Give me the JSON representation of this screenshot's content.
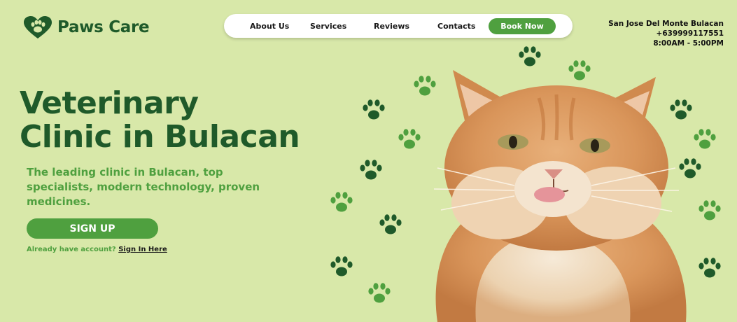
{
  "brand": {
    "name": "Paws Care",
    "logo_icon": "heart-paw-icon"
  },
  "nav": {
    "items": [
      "About Us",
      "Services",
      "Reviews",
      "Contacts"
    ],
    "book_label": "Book Now"
  },
  "contact": {
    "address": "San Jose Del Monte Bulacan",
    "phone": "+639999117551",
    "hours": "8:00AM - 5:00PM"
  },
  "hero": {
    "title_line1": "Veterinary",
    "title_line2": "Clinic in Bulacan",
    "subtitle": "The leading clinic in Bulacan, top specialists, modern technology, proven medicines.",
    "signup_label": "SIGN UP",
    "account_prompt": "Already have account?",
    "signin_label": "Sign In Here"
  },
  "colors": {
    "background": "#d8e8a9",
    "dark_green": "#1f5a2a",
    "accent_green": "#4fa03f"
  }
}
